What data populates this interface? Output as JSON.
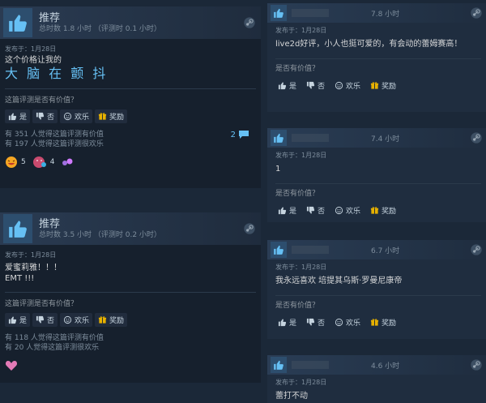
{
  "left_reviews": [
    {
      "title": "推荐",
      "hours": "总时数 1.8 小时 （评测时 0.1 小时）",
      "posted": "发布于：1月28日",
      "text_line1": "这个价格让我的",
      "text_big": "大 脑 在 颤 抖",
      "helpful_question": "这篇评测是否有价值？",
      "buttons": {
        "yes": "是",
        "no": "否",
        "funny": "欢乐",
        "award": "奖励"
      },
      "stat_helpful": "有 351 人觉得这篇评测有价值",
      "stat_funny": "有 197 人觉得这篇评测很欢乐",
      "comment_count": "2",
      "awards": [
        {
          "icon": "laughing-face-icon",
          "count": "5"
        },
        {
          "icon": "heart-eyes-icon",
          "count": "4"
        },
        {
          "icon": "sparkle-icon",
          "count": ""
        }
      ]
    },
    {
      "title": "推荐",
      "hours": "总时数 3.5 小时 （评测时 0.2 小时）",
      "posted": "发布于：1月28日",
      "text_line1": "爱蜜莉雅！！！",
      "text_line2": "EMT !!!",
      "helpful_question": "这篇评测是否有价值？",
      "buttons": {
        "yes": "是",
        "no": "否",
        "funny": "欢乐",
        "award": "奖励"
      },
      "stat_helpful": "有 118 人觉得这篇评测有价值",
      "stat_funny": "有 20 人觉得这篇评测很欢乐"
    }
  ],
  "right_reviews": [
    {
      "hours": "7.8 小时",
      "posted": "发布于：1月28日",
      "text": "live2d好评，小人也挺可爱的，有会动的蕾姆赛高！",
      "helpful_question": "是否有价值？",
      "buttons": {
        "yes": "是",
        "no": "否",
        "funny": "欢乐",
        "award": "奖励"
      }
    },
    {
      "hours": "7.4 小时",
      "posted": "发布于：1月28日",
      "text": "1",
      "helpful_question": "是否有价值？",
      "buttons": {
        "yes": "是",
        "no": "否",
        "funny": "欢乐",
        "award": "奖励"
      }
    },
    {
      "hours": "6.7 小时",
      "posted": "发布于：1月28日",
      "text": "我永远喜欢 培提其乌斯·罗曼尼康帝",
      "helpful_question": "是否有价值？",
      "buttons": {
        "yes": "是",
        "no": "否",
        "funny": "欢乐",
        "award": "奖励"
      }
    },
    {
      "hours": "4.6 小时",
      "posted": "发布于：1月28日",
      "text": "蕾打不动"
    }
  ],
  "colors": {
    "background": "#1b2838",
    "accent": "#66c0f4",
    "award_gold": "#e7b100"
  }
}
